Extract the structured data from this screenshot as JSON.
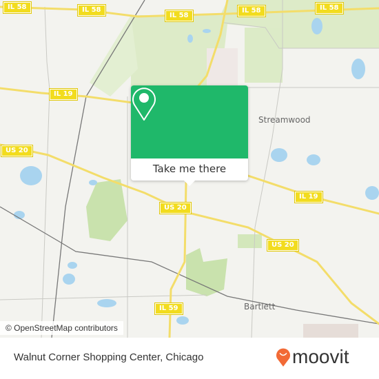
{
  "map": {
    "road_shields": [
      {
        "label": "IL 58",
        "name": "il58-shield-1"
      },
      {
        "label": "IL 58",
        "name": "il58-shield-2"
      },
      {
        "label": "IL 58",
        "name": "il58-shield-3"
      },
      {
        "label": "IL 58",
        "name": "il58-shield-4"
      },
      {
        "label": "IL 58",
        "name": "il58-shield-5"
      },
      {
        "label": "IL 19",
        "name": "il19-shield-1"
      },
      {
        "label": "IL 19",
        "name": "il19-shield-2"
      },
      {
        "label": "US 20",
        "name": "us20-shield-1"
      },
      {
        "label": "US 20",
        "name": "us20-shield-2"
      },
      {
        "label": "US 20",
        "name": "us20-shield-3"
      },
      {
        "label": "IL 59",
        "name": "il59-shield-1"
      }
    ],
    "towns": [
      "Streamwood",
      "Bartlett"
    ],
    "attribution": "© OpenStreetMap contributors",
    "popup": {
      "button_label": "Take me there",
      "icon": "map-pin-icon",
      "color": "#1fb86a"
    }
  },
  "footer": {
    "place_name": "Walnut Corner Shopping Center, Chicago",
    "brand": "moovit",
    "brand_color": "#f26a36"
  }
}
